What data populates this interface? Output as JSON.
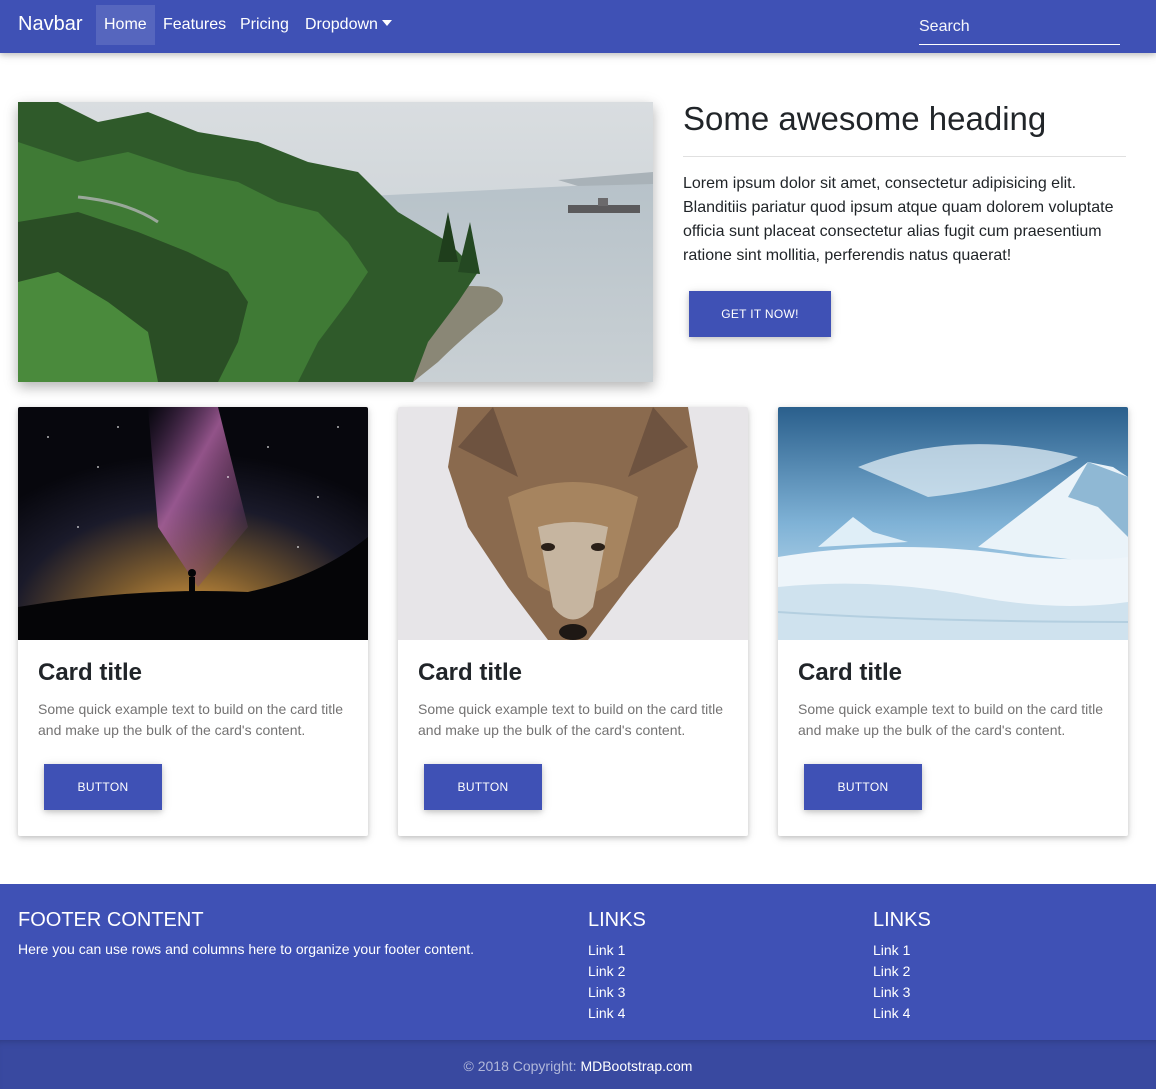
{
  "navbar": {
    "brand": "Navbar",
    "items": [
      {
        "label": "Home",
        "active": true
      },
      {
        "label": "Features"
      },
      {
        "label": "Pricing"
      },
      {
        "label": "Dropdown"
      }
    ],
    "search_placeholder": "Search"
  },
  "hero": {
    "image": "forest-coast-image",
    "heading": "Some awesome heading",
    "text": "Lorem ipsum dolor sit amet, consectetur adipisicing elit. Blanditiis pariatur quod ipsum atque quam dolorem voluptate officia sunt placeat consectetur alias fugit cum praesentium ratione sint mollitia, perferendis natus quaerat!",
    "button": "Get it now!"
  },
  "cards": [
    {
      "image": "milky-way-image",
      "title": "Card title",
      "text": "Some quick example text to build on the card title and make up the bulk of the card's content.",
      "button": "Button"
    },
    {
      "image": "coyote-image",
      "title": "Card title",
      "text": "Some quick example text to build on the card title and make up the bulk of the card's content.",
      "button": "Button"
    },
    {
      "image": "snowy-mountain-image",
      "title": "Card title",
      "text": "Some quick example text to build on the card title and make up the bulk of the card's content.",
      "button": "Button"
    }
  ],
  "footer": {
    "content_title": "Footer Content",
    "content_text": "Here you can use rows and columns here to organize your footer content.",
    "columns": [
      {
        "title": "Links",
        "links": [
          "Link 1",
          "Link 2",
          "Link 3",
          "Link 4"
        ]
      },
      {
        "title": "Links",
        "links": [
          "Link 1",
          "Link 2",
          "Link 3",
          "Link 4"
        ]
      }
    ],
    "copyright_prefix": "© 2018 Copyright:",
    "copyright_link": "MDBootstrap.com"
  },
  "colors": {
    "primary": "#3f51b5",
    "copyright_bg": "#3949a0"
  }
}
